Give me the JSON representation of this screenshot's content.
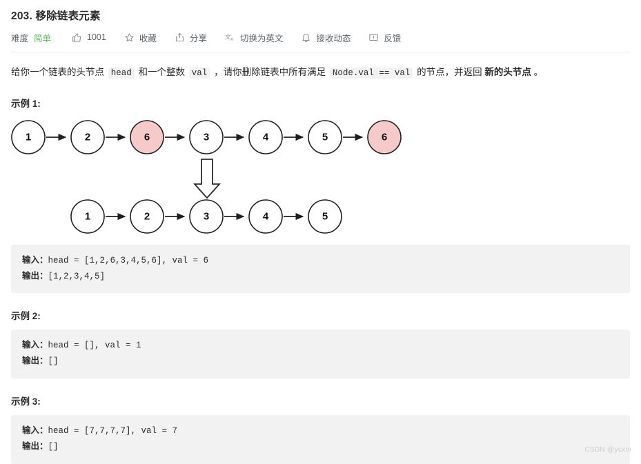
{
  "problem": {
    "title": "203. 移除链表元素",
    "difficulty_label": "难度",
    "difficulty_value": "简单",
    "difficulty_color": "#5cb85c",
    "likes": "1001",
    "favorite_label": "收藏",
    "share_label": "分享",
    "translate_label": "切换为英文",
    "subscribe_label": "接收动态",
    "feedback_label": "反馈"
  },
  "description": {
    "part1": "给你一个链表的头节点 ",
    "code1": "head",
    "part2": " 和一个整数 ",
    "code2": "val",
    "part3": " ，请你删除链表中所有满足 ",
    "code3": "Node.val == val",
    "part4": " 的节点，并返回 ",
    "bold1": "新的头节点",
    "part5": " 。"
  },
  "examples": [
    {
      "heading": "示例 1:",
      "input_label": "输入：",
      "input_value": "head = [1,2,6,3,4,5,6], val = 6",
      "output_label": "输出：",
      "output_value": "[1,2,3,4,5]"
    },
    {
      "heading": "示例 2:",
      "input_label": "输入：",
      "input_value": "head = [], val = 1",
      "output_label": "输出：",
      "output_value": "[]"
    },
    {
      "heading": "示例 3:",
      "input_label": "输入：",
      "input_value": "head = [7,7,7,7], val = 7",
      "output_label": "输出：",
      "output_value": "[]"
    }
  ],
  "diagram": {
    "before_nodes": [
      "1",
      "2",
      "6",
      "3",
      "4",
      "5",
      "6"
    ],
    "before_highlight_indices": [
      2,
      6
    ],
    "after_nodes": [
      "1",
      "2",
      "3",
      "4",
      "5"
    ],
    "highlight_color": "#f7caca",
    "node_fill": "#ffffff",
    "stroke_color": "#1f1f1f",
    "arrow_marker_label": "down-arrow-above-node-3"
  },
  "watermark": "CSDN @ycxm"
}
